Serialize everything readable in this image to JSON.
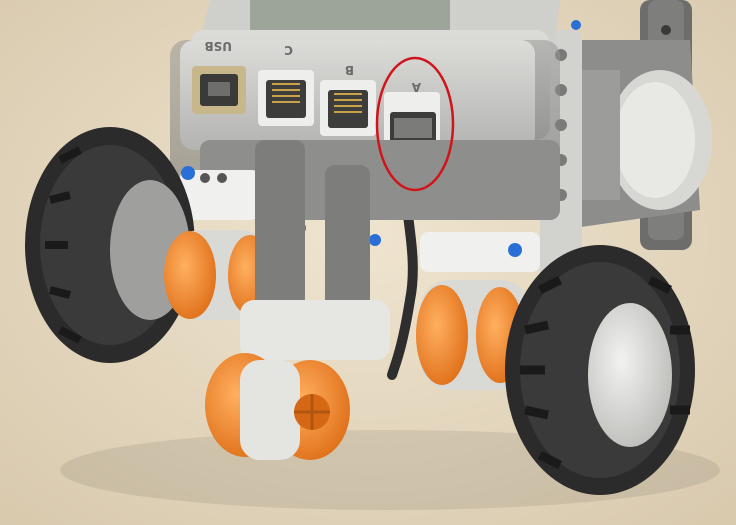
{
  "photo": {
    "subject": "lego-nxt-robot-rear-view",
    "ports": {
      "usb": "USB",
      "c": "C",
      "b": "B",
      "a": "A"
    },
    "highlight": {
      "target_port": "A",
      "color": "#d0141c"
    },
    "colors": {
      "background": "#e4d7bf",
      "brick_gray": "#c9c9c6",
      "dark_gray": "#7c7d7b",
      "tire_black": "#2b2b2b",
      "hub_orange": "#f08a24",
      "axle_blue": "#2a6fd6"
    }
  }
}
